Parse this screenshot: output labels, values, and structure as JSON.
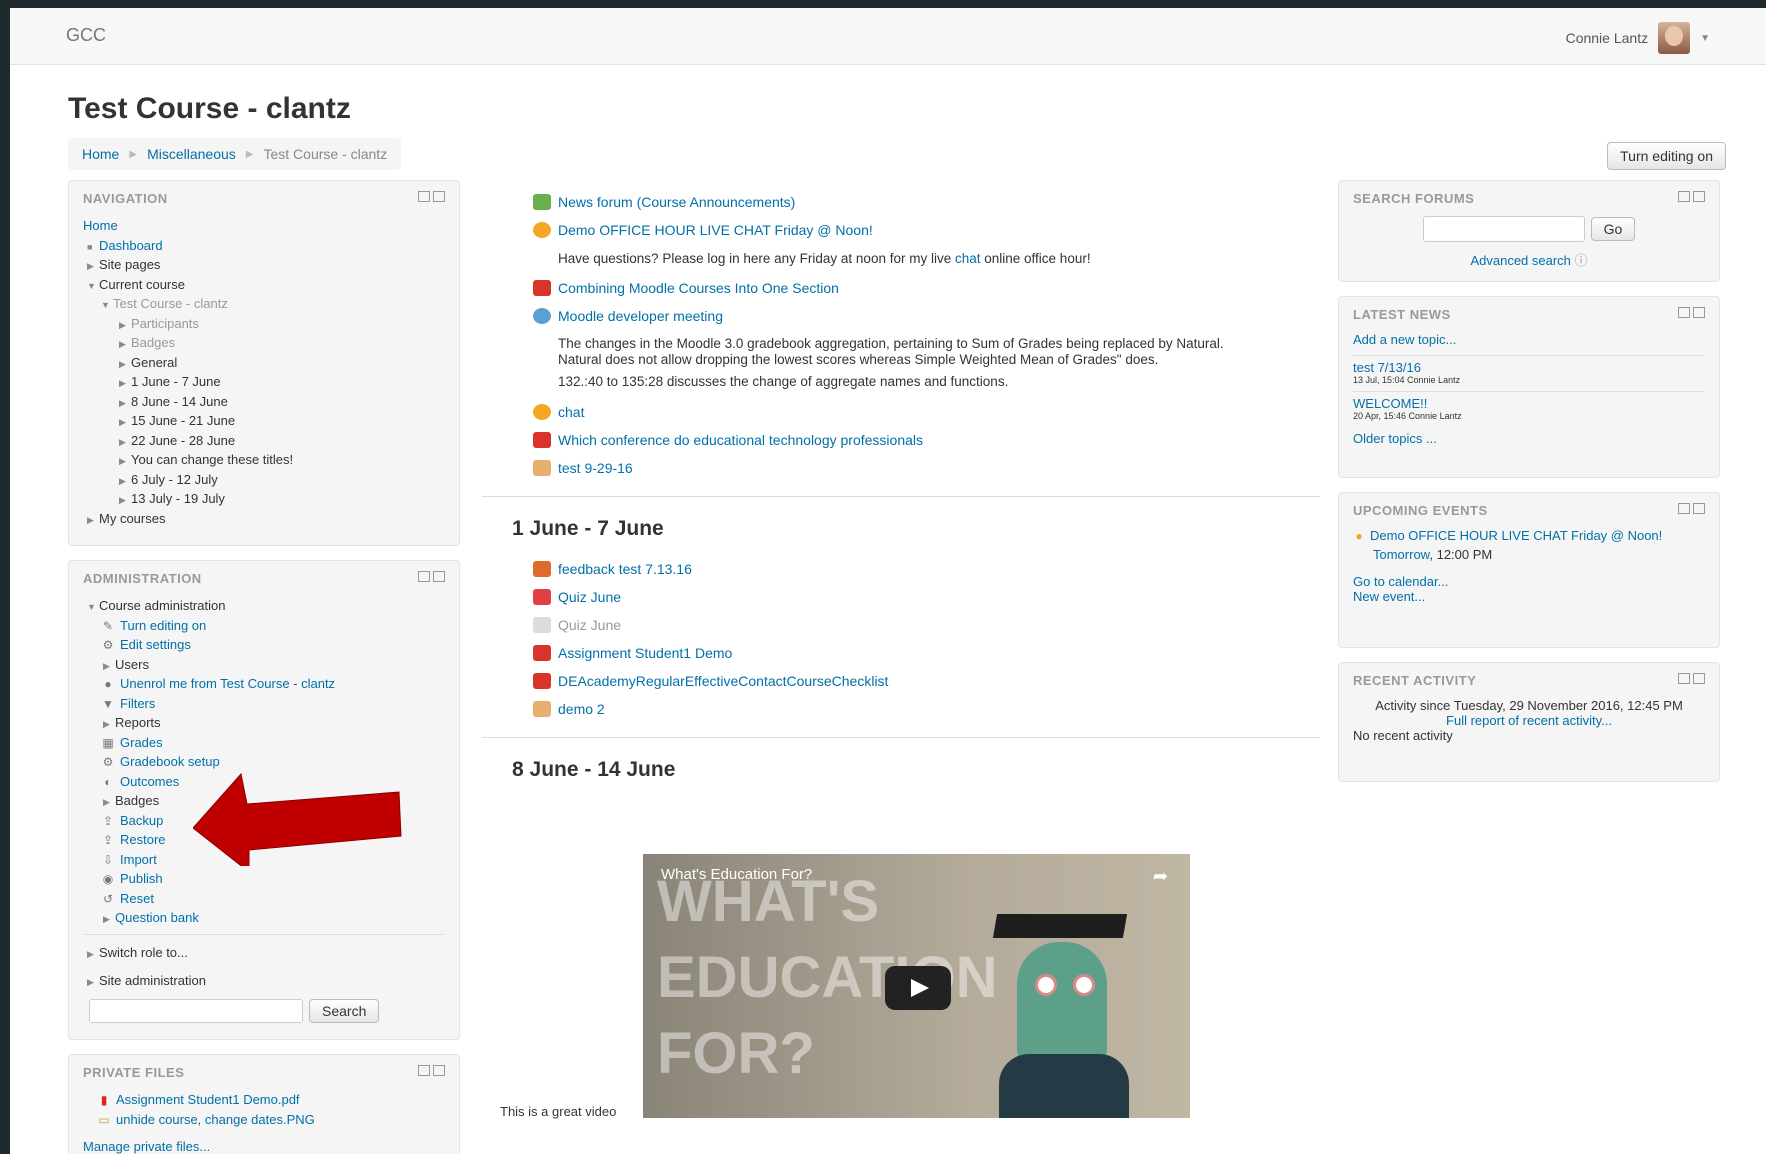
{
  "header": {
    "brand": "GCC",
    "user_name": "Connie Lantz"
  },
  "page": {
    "title": "Test Course - clantz",
    "breadcrumb": [
      "Home",
      "Miscellaneous",
      "Test Course - clantz"
    ],
    "edit_button": "Turn editing on"
  },
  "navigation": {
    "title": "NAVIGATION",
    "items": [
      "Home",
      "Dashboard",
      "Site pages",
      "Current course",
      "Test Course - clantz",
      "Participants",
      "Badges",
      "General",
      "1 June - 7 June",
      "8 June - 14 June",
      "15 June - 21 June",
      "22 June - 28 June",
      "You can change these titles!",
      "6 July - 12 July",
      "13 July - 19 July",
      "My courses"
    ]
  },
  "administration": {
    "title": "ADMINISTRATION",
    "items": [
      "Course administration",
      "Turn editing on",
      "Edit settings",
      "Users",
      "Unenrol me from Test Course - clantz",
      "Filters",
      "Reports",
      "Grades",
      "Gradebook setup",
      "Outcomes",
      "Badges",
      "Backup",
      "Restore",
      "Import",
      "Publish",
      "Reset",
      "Question bank",
      "Switch role to...",
      "Site administration"
    ],
    "search_button": "Search"
  },
  "private_files": {
    "title": "PRIVATE FILES",
    "files": [
      "Assignment Student1 Demo.pdf",
      "unhide course, change dates.PNG"
    ],
    "manage": "Manage private files..."
  },
  "main": {
    "top": [
      "News forum (Course Announcements)",
      "Demo OFFICE HOUR LIVE CHAT Friday @ Noon!"
    ],
    "chat_desc_a": "Have questions? Please log in here any Friday at noon for my live ",
    "chat_desc_link": "chat",
    "chat_desc_b": " online office hour!",
    "top2": [
      "Combining Moodle Courses Into One Section",
      "Moodle developer meeting"
    ],
    "desc1": "The changes in the Moodle 3.0 gradebook aggregation, pertaining to Sum of Grades being replaced by Natural. Natural does not allow dropping the lowest scores whereas Simple Weighted Mean of Grades\" does.",
    "desc2": "132.:40 to 135:28 discusses the change of aggregate names and functions.",
    "top3": [
      "chat",
      "Which conference do educational technology professionals",
      "test 9-29-16"
    ],
    "section1_title": "1 June - 7 June",
    "section1": [
      "feedback test 7.13.16",
      "Quiz June",
      "Quiz June",
      "Assignment Student1 Demo",
      "DEAcademyRegularEffectiveContactCourseChecklist",
      "demo 2"
    ],
    "section2_title": "8 June - 14 June",
    "video_title": "What's Education For?",
    "video_big": [
      "WHAT'S",
      "EDUCATION",
      "FOR?"
    ],
    "video_caption": "This is a great video"
  },
  "search_forums": {
    "title": "SEARCH FORUMS",
    "go": "Go",
    "advanced": "Advanced search"
  },
  "latest_news": {
    "title": "LATEST NEWS",
    "add": "Add a new topic...",
    "items": [
      {
        "title": "test 7/13/16",
        "meta": "13 Jul, 15:04 Connie Lantz"
      },
      {
        "title": "WELCOME!!",
        "meta": "20 Apr, 15:46 Connie Lantz"
      }
    ],
    "older": "Older topics ..."
  },
  "upcoming": {
    "title": "UPCOMING EVENTS",
    "event": "Demo OFFICE HOUR LIVE CHAT Friday @ Noon!",
    "when_link": "Tomorrow",
    "when_time": ", 12:00 PM",
    "calendar": "Go to calendar...",
    "new_event": "New event..."
  },
  "recent": {
    "title": "RECENT ACTIVITY",
    "since": "Activity since Tuesday, 29 November 2016, 12:45 PM",
    "report": "Full report of recent activity...",
    "none": "No recent activity"
  },
  "colors": {
    "link": "#0070a8",
    "arrow": "#c00000",
    "block_bg": "#f5f5f5"
  }
}
